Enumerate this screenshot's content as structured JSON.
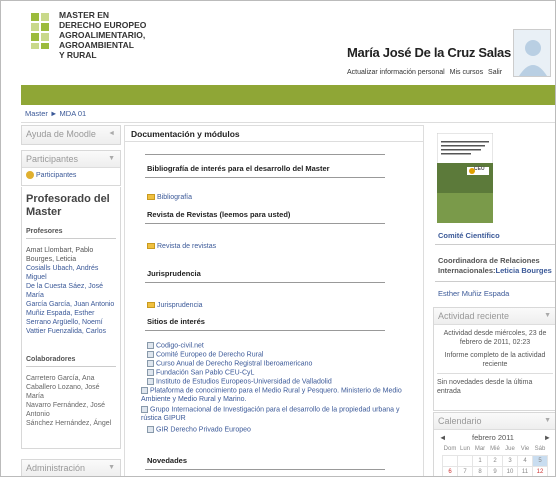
{
  "header": {
    "logo_lines": [
      "MASTER EN",
      "DERECHO EUROPEO",
      "AGROALIMENTARIO,",
      "AGROAMBIENTAL",
      "Y RURAL"
    ],
    "user_name": "María José De la Cruz Salas",
    "links": [
      "Actualizar información personal",
      "Mis cursos",
      "Salir"
    ]
  },
  "breadcrumb": {
    "home": "Master",
    "sep": "►",
    "current": "MDA 01"
  },
  "left": {
    "help_title": "Ayuda de Moodle",
    "participants_title": "Participantes",
    "participants_link": "Participantes",
    "faculty_title": "Profesorado del Master",
    "profesores_label": "Profesores",
    "profesores": [
      "Amat Llombart, Pablo",
      "Bourges, Leticia",
      "Cosialls Ubach, Andrés Miguel",
      "De la Cuesta Sáez, José María",
      "García García, Juan Antonio",
      "Muñiz Espada, Esther",
      "Serrano Argüello, Noemí",
      "Vattier Fuenzalida, Carlos"
    ],
    "colaboradores_label": "Colaboradores",
    "colaboradores": [
      "Carretero García, Ana",
      "Caballero Lozano, José María",
      "Navarro Fernández, José Antonio",
      "Sánchez Hernández, Ángel"
    ],
    "admin_title": "Administración"
  },
  "main": {
    "header": "Documentación y módulos",
    "sections": {
      "bibliografia_title": "Bibliografía de interés para el desarrollo del Master",
      "bibliografia_link": "Bibliografía",
      "revistas_title": "Revista de Revistas (leemos para usted)",
      "revistas_link": "Revista de revistas",
      "jurisprudencia_title": "Jurisprudencia",
      "jurisprudencia_link": "Jurisprudencia",
      "sitios_title": "Sitios de interés",
      "sitios": [
        "Codigo-civil.net",
        "Comité Europeo de Derecho Rural",
        "Curso Anual de Derecho Registral Iberoamericano",
        "Fundación San Pablo CEU-CyL",
        "Instituto de Estudios Europeos-Universidad de Valladolid",
        "Plataforma de conocimiento para el Medio Rural y Pesquero. Ministerio de Medio Ambiente y Medio Rural y Marino.",
        "Grupo Internacional de Investigación para el desarrollo de la propiedad urbana y rústica GIPUR",
        "GIR Derecho Privado Europeo"
      ],
      "novedades_title": "Novedades"
    }
  },
  "right": {
    "comite": "Comité Científico",
    "coordinadora_label": "Coordinadora de Relaciones Internacionales:",
    "coordinadora_name": "Leticia Bourges",
    "esther": "Esther Muñiz Espada",
    "actividad_title": "Actividad reciente",
    "actividad_text": "Actividad desde miércoles, 23 de febrero de 2011, 02:23",
    "informe": "Informe completo de la actividad reciente",
    "sin_novedades": "Sin novedades desde la última entrada",
    "calendar_title": "Calendario",
    "month": "febrero 2011",
    "prev": "◄",
    "next": "►",
    "days": [
      "Dom",
      "Lun",
      "Mar",
      "Mié",
      "Jue",
      "Vie",
      "Sáb"
    ],
    "week1": [
      "",
      "",
      "1",
      "2",
      "3",
      "4",
      "5"
    ],
    "week2": [
      "6",
      "7",
      "8",
      "9",
      "10",
      "11",
      "12"
    ],
    "book_caption": "CEU"
  },
  "colors": {
    "accent_green": "#8fa636",
    "link_blue": "#3b5998"
  }
}
